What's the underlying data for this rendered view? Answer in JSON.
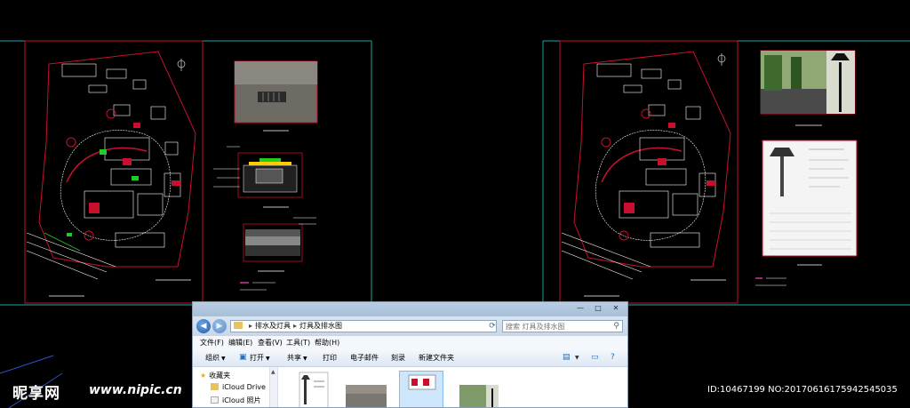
{
  "explorer": {
    "breadcrumb": [
      "排水及灯具",
      "灯具及排水图"
    ],
    "search_placeholder": "搜索 灯具及排水图",
    "menu": [
      "文件(F)",
      "编辑(E)",
      "查看(V)",
      "工具(T)",
      "帮助(H)"
    ],
    "toolbar": [
      "组织",
      "打开",
      "共享",
      "打印",
      "电子邮件",
      "刻录",
      "新建文件夹"
    ],
    "nav": [
      "收藏夹",
      "iCloud Drive",
      "iCloud 照片"
    ]
  },
  "watermark": {
    "logo": "昵享网",
    "url": "www.nipic.cn",
    "id": "ID:10467199 NO:20170616175942545035"
  },
  "colors": {
    "background": "#000000",
    "frame": "#1aa6a6",
    "border": "#c8102e",
    "linework": "#ffffff",
    "accent_green": "#22cc22",
    "accent_magenta": "#ff44cc"
  }
}
